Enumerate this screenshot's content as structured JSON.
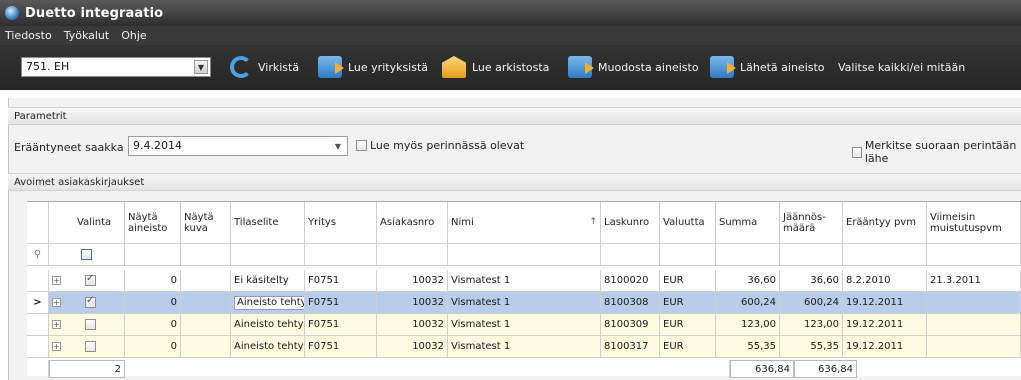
{
  "window": {
    "title": "Duetto integraatio"
  },
  "menu": {
    "items": [
      "Tiedosto",
      "Työkalut",
      "Ohje"
    ]
  },
  "toolbar": {
    "company_select": "751. EH",
    "buttons": {
      "refresh": "Virkistä",
      "read_companies": "Lue yrityksistä",
      "read_archive": "Lue arkistosta",
      "build_material": "Muodosta aineisto",
      "send_material": "Lähetä aineisto",
      "select_all_none": "Valitse kaikki/ei mitään"
    }
  },
  "params": {
    "section_title": "Parametrit",
    "due_label": "Erääntyneet saakka",
    "due_value": "9.4.2014",
    "read_collection_label": "Lue myös perinnässä olevat",
    "mark_direct_label": "Merkitse suoraan perintään lähe"
  },
  "grid": {
    "section_title": "Avoimet asiakaskirjaukset",
    "columns": [
      "Valinta",
      "Näytä aineisto",
      "Näytä kuva",
      "Tilaselite",
      "Yritys",
      "Asiakasnro",
      "Nimi",
      "Laskunro",
      "Valuutta",
      "Summa",
      "Jäännös-määrä",
      "Erääntyy pvm",
      "Viimeisin muistutuspvm"
    ],
    "rows": [
      {
        "checked": true,
        "nayta": "0",
        "tila": "Ei käsitelty",
        "yritys": "F0751",
        "asiakas": "10032",
        "nimi": "Vismatest 1",
        "lasku": "8100020",
        "valuutta": "EUR",
        "summa": "36,60",
        "jaannos": "36,60",
        "erantyy": "8.2.2010",
        "muistutus": "21.3.2011",
        "style": "white"
      },
      {
        "checked": true,
        "nayta": "0",
        "tila": "Aineisto tehty",
        "yritys": "F0751",
        "asiakas": "10032",
        "nimi": "Vismatest 1",
        "lasku": "8100308",
        "valuutta": "EUR",
        "summa": "600,24",
        "jaannos": "600,24",
        "erantyy": "19.12.2011",
        "muistutus": "",
        "style": "selected"
      },
      {
        "checked": false,
        "nayta": "0",
        "tila": "Aineisto tehty",
        "yritys": "F0751",
        "asiakas": "10032",
        "nimi": "Vismatest 1",
        "lasku": "8100309",
        "valuutta": "EUR",
        "summa": "123,00",
        "jaannos": "123,00",
        "erantyy": "19.12.2011",
        "muistutus": "",
        "style": "yellow"
      },
      {
        "checked": false,
        "nayta": "0",
        "tila": "Aineisto tehty",
        "yritys": "F0751",
        "asiakas": "10032",
        "nimi": "Vismatest 1",
        "lasku": "8100317",
        "valuutta": "EUR",
        "summa": "55,35",
        "jaannos": "55,35",
        "erantyy": "19.12.2011",
        "muistutus": "",
        "style": "yellow"
      }
    ],
    "footer": {
      "count": "2",
      "summa_total": "636,84",
      "jaannos_total": "636,84"
    }
  }
}
